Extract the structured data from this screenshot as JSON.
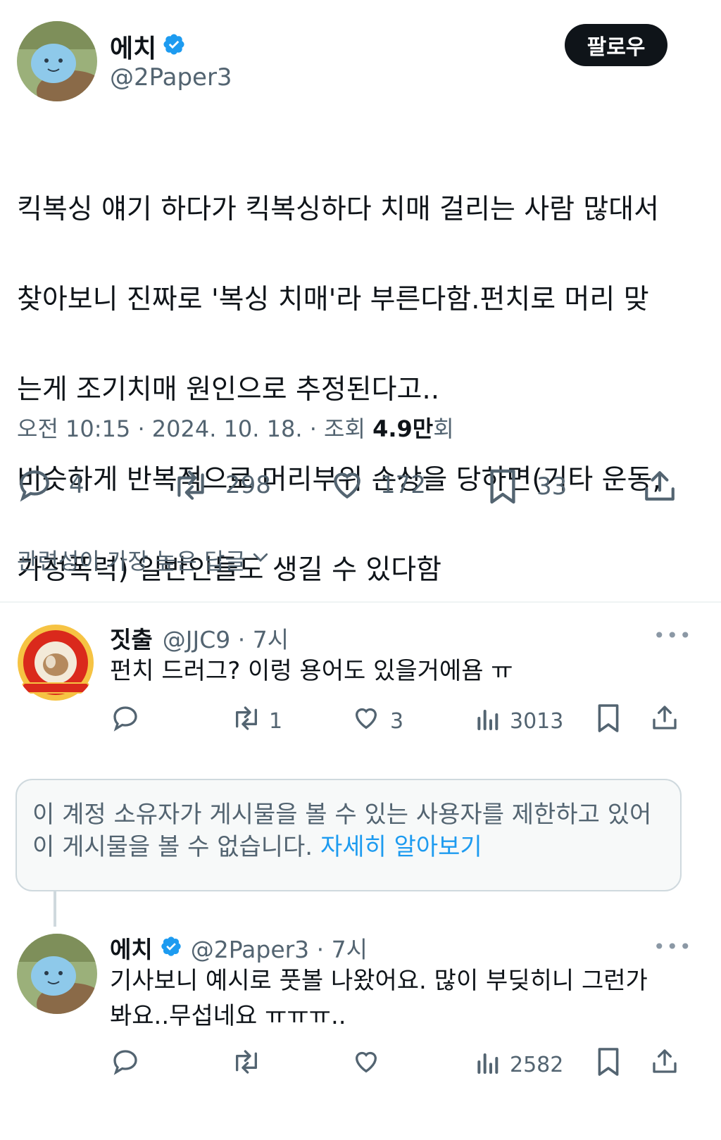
{
  "tweet": {
    "author_name": "에치",
    "author_handle": "@2Paper3",
    "follow_label": "팔로우",
    "lines": [
      "킥복싱 얘기 하다가 킥복싱하다 치매 걸리는 사람 많대서",
      "찾아보니 진짜로 '복싱 치매'라 부른다함.펀치로 머리 맞",
      "는게 조기치매 원인으로 추정된다고..",
      "비슷하게 반복적으로 머리부위 손상을 당하면(기타 운동,",
      "가정폭력) 일반인들도 생길 수 있다함"
    ],
    "time": "오전 10:15 · 2024. 10. 18. · 조회 ",
    "views": "4.9만",
    "views_suffix": "회",
    "replies": "4",
    "retweets": "298",
    "likes": "172",
    "bookmarks": "33"
  },
  "sort_label": "관련성이 가장 높은 답글",
  "reply1": {
    "name": "짓출",
    "meta": "@JJC9 · 7시",
    "text": "펀치 드러그? 이렁 용어도 있을거에욤 ㅠ",
    "retweets": "1",
    "likes": "3",
    "views": "3013",
    "more": "•••"
  },
  "notice": {
    "text": "이 계정 소유자가 게시물을 볼 수 있는 사용자를 제한하고 있어 이 게시물을 볼 수 없습니다. ",
    "link": "자세히 알아보기"
  },
  "reply2": {
    "name": "에치",
    "meta": "@2Paper3 · 7시",
    "line1": "기사보니 예시로 풋볼 나왔어요. 많이 부딪히니 그런가",
    "line2": "봐요..무섭네요 ㅠㅠㅠ..",
    "views": "2582",
    "more": "•••"
  },
  "colors": {
    "accent": "#1d9bf0",
    "text": "#0f1419",
    "muted": "#536471"
  }
}
